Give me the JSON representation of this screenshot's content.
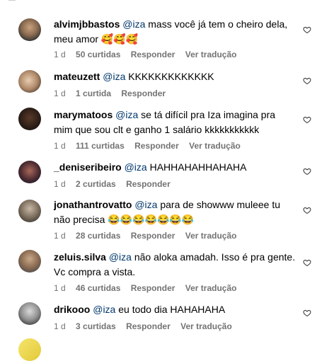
{
  "comments": [
    {
      "user": "alvimjbbastos",
      "mention": "@iza",
      "text": " mass você já tem o cheiro dela, meu amor 🥰🥰🥰",
      "time": "1 d",
      "likes": "50 curtidas",
      "reply": "Responder",
      "translate": "Ver tradução"
    },
    {
      "user": "mateuzett",
      "mention": "@iza",
      "text": " KKKKKKKKKKKKK",
      "time": "1 d",
      "likes": "1 curtida",
      "reply": "Responder",
      "translate": ""
    },
    {
      "user": "marymatoos",
      "mention": "@iza",
      "text": " se tá difícil pra Iza imagina pra mim que sou clt e ganho 1 salário kkkkkkkkkkk",
      "time": "1 d",
      "likes": "111 curtidas",
      "reply": "Responder",
      "translate": "Ver tradução"
    },
    {
      "user": "_deniseribeiro",
      "mention": "@iza",
      "text": " HAHHAHAHHAHAHA",
      "time": "1 d",
      "likes": "2 curtidas",
      "reply": "Responder",
      "translate": ""
    },
    {
      "user": "jonathantrovatto",
      "mention": "@iza",
      "text": " para de showww muleee tu não precisa 😂😂😂😂😂😂😂",
      "time": "1 d",
      "likes": "28 curtidas",
      "reply": "Responder",
      "translate": "Ver tradução"
    },
    {
      "user": "zeluis.silva",
      "mention": "@iza",
      "text": " não aloka amadah. Isso é pra gente. Vc compra a vista.",
      "time": "1 d",
      "likes": "46 curtidas",
      "reply": "Responder",
      "translate": "Ver tradução"
    },
    {
      "user": "drikooo",
      "mention": "@iza",
      "text": " eu todo dia HAHAHAHA",
      "time": "1 d",
      "likes": "3 curtidas",
      "reply": "Responder",
      "translate": "Ver tradução"
    }
  ],
  "icons": {
    "like": "heart-outline-icon"
  }
}
